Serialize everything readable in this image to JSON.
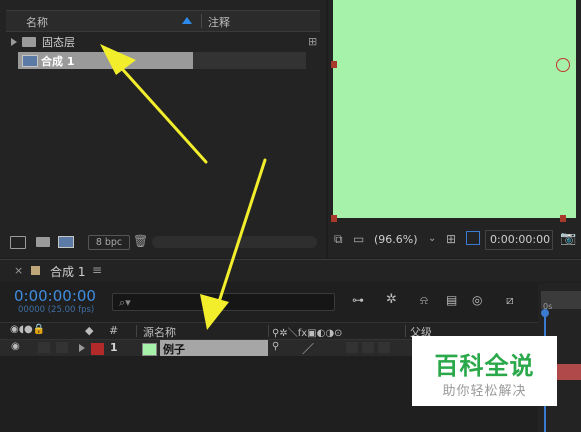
{
  "project": {
    "col_name": "名称",
    "col_comment": "注释",
    "items": [
      {
        "label": "固态层",
        "icon": "folder-icon"
      },
      {
        "label": "合成 1",
        "icon": "composition-icon"
      }
    ],
    "bpc": "8 bpc"
  },
  "viewer": {
    "background_color": "#a6f2ab",
    "zoom": "(96.6%)",
    "timecode": "0:00:00:00"
  },
  "timeline": {
    "tab_label": "合成 1",
    "timecode": "0:00:00:00",
    "fps": "00000 (25.00 fps)",
    "col_number": "#",
    "col_source_name": "源名称",
    "col_parent": "父级",
    "ruler_start": "0s",
    "layer": {
      "number": "1",
      "name": "例子",
      "label_color": "#b32a2a"
    }
  },
  "watermark": {
    "title": "百科全说",
    "subtitle": "助你轻松解决"
  },
  "annotation": {
    "arrow_color": "#f2ee2c"
  }
}
